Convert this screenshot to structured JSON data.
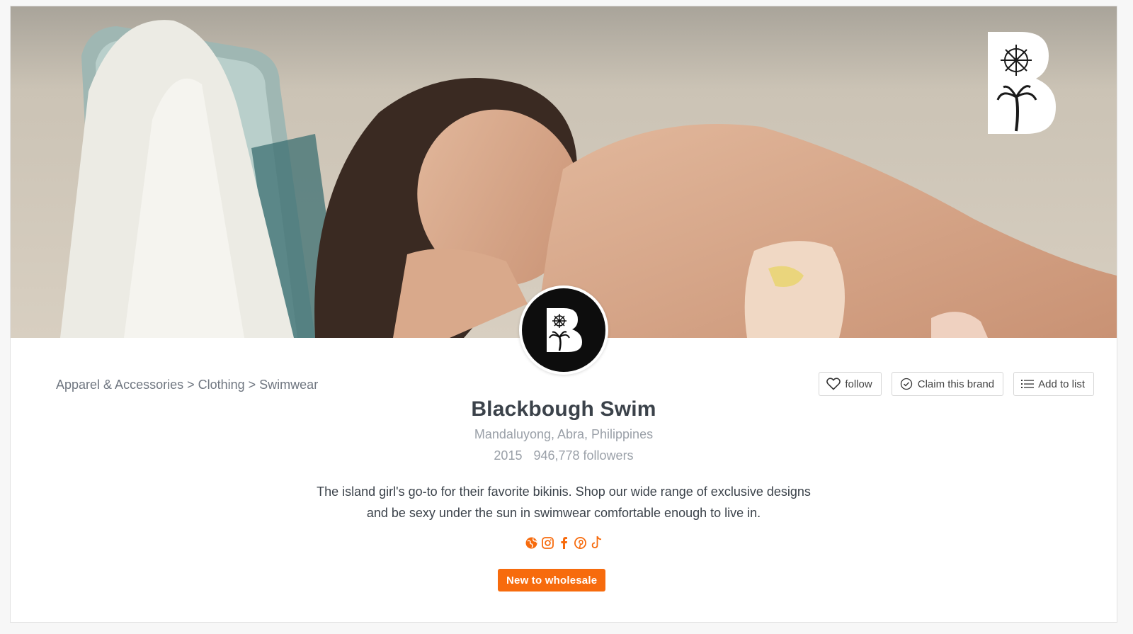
{
  "brand": {
    "name": "Blackbough Swim",
    "location": "Mandaluyong, Abra, Philippines",
    "founded": "2015",
    "followers": "946,778 followers",
    "description": "The island girl's go-to for their favorite bikinis. Shop our wide range of exclusive designs and be sexy under the sun in swimwear comfortable enough to live in."
  },
  "breadcrumb": {
    "items": [
      "Apparel & Accessories",
      "Clothing",
      "Swimwear"
    ],
    "separator": ">"
  },
  "actions": {
    "follow_label": "follow",
    "claim_label": "Claim this brand",
    "add_list_label": "Add to list"
  },
  "socials": [
    {
      "name": "website-icon"
    },
    {
      "name": "instagram-icon"
    },
    {
      "name": "facebook-icon"
    },
    {
      "name": "pinterest-icon"
    },
    {
      "name": "tiktok-icon"
    }
  ],
  "badge": {
    "label": "New to wholesale"
  },
  "colors": {
    "accent": "#f76b0d",
    "text_dark": "#3b424a",
    "text_muted": "#9aa0a8"
  }
}
